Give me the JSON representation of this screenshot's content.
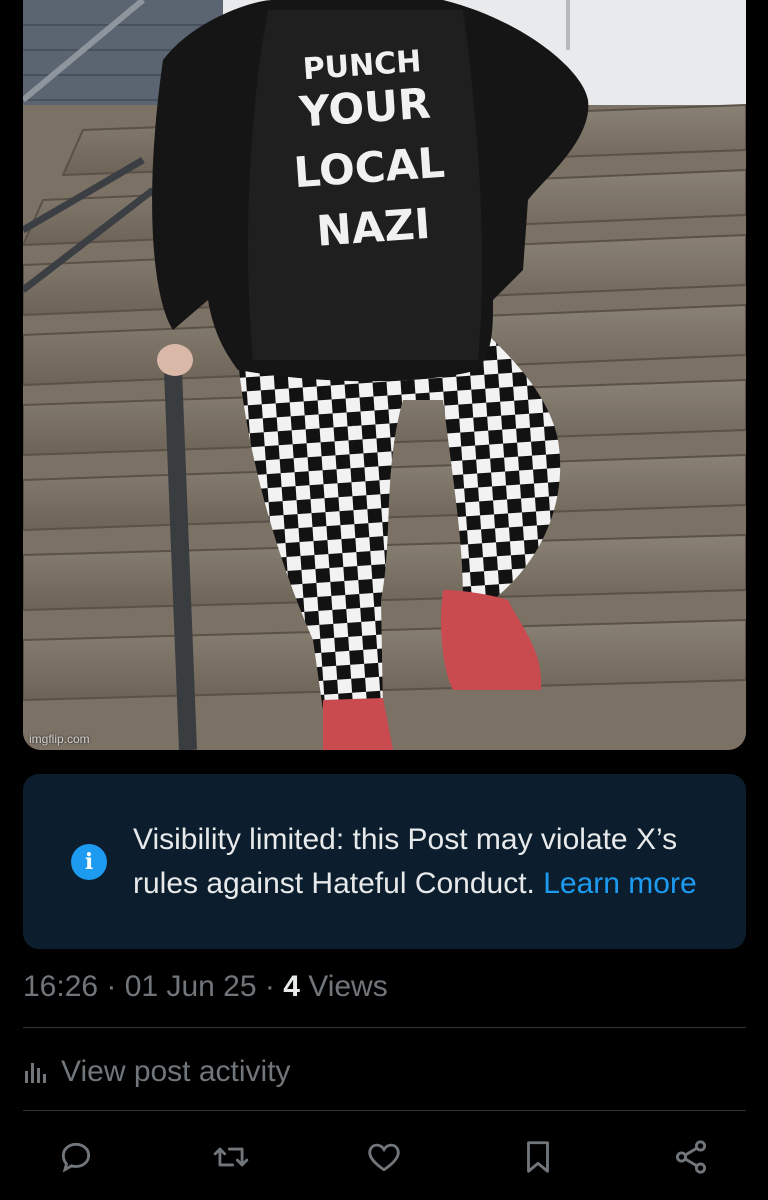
{
  "media": {
    "watermark": "imgflip.com",
    "shirt_text": [
      "PUNCH",
      "YOUR",
      "LOCAL",
      "NAZI"
    ]
  },
  "notice": {
    "icon": "info-icon",
    "message": "Visibility limited: this Post may violate X’s rules against Hateful Conduct. ",
    "link_label": "Learn more",
    "accent_color": "#1d9bf0",
    "background_color": "#0c1e2d"
  },
  "meta": {
    "time": "16:26",
    "separator": " · ",
    "date": "01 Jun 25",
    "views_count": "4",
    "views_label": " Views"
  },
  "activity": {
    "icon": "bar-chart-icon",
    "label": "View post activity"
  },
  "actions": [
    {
      "name": "reply",
      "icon": "reply-icon"
    },
    {
      "name": "repost",
      "icon": "repost-icon"
    },
    {
      "name": "like",
      "icon": "heart-icon"
    },
    {
      "name": "bookmark",
      "icon": "bookmark-icon"
    },
    {
      "name": "share",
      "icon": "share-icon"
    }
  ]
}
